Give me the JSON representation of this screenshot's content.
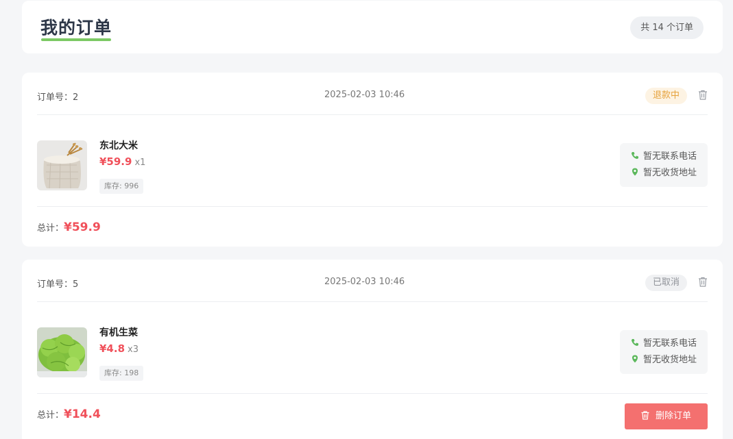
{
  "header": {
    "title": "我的订单",
    "count_label": "共 14 个订单"
  },
  "orders": [
    {
      "order_no": "订单号：2",
      "time": "2025-02-03 10:46",
      "status": "退款中",
      "item": {
        "name": "东北大米",
        "price": "¥59.9",
        "qty": "x1",
        "stock": "库存: 996",
        "image": "rice-sack-image"
      },
      "contact": {
        "phone": "暂无联系电话",
        "address": "暂无收货地址"
      },
      "total_label": "总计：",
      "total_value": "¥59.9"
    },
    {
      "order_no": "订单号：5",
      "time": "2025-02-03 10:46",
      "status": "已取消",
      "item": {
        "name": "有机生菜",
        "price": "¥4.8",
        "qty": "x3",
        "stock": "库存: 198",
        "image": "lettuce-image"
      },
      "contact": {
        "phone": "暂无联系电话",
        "address": "暂无收货地址"
      },
      "total_label": "总计：",
      "total_value": "¥14.4",
      "delete_label": "删除订单"
    }
  ],
  "colors": {
    "accent_green": "#7cc964",
    "price_red": "#f0505a",
    "refund_orange": "#e6a23c",
    "delete_button": "#f4706f"
  },
  "icons": {
    "trash": "trash-icon",
    "phone": "phone-icon",
    "location": "location-pin-icon"
  }
}
